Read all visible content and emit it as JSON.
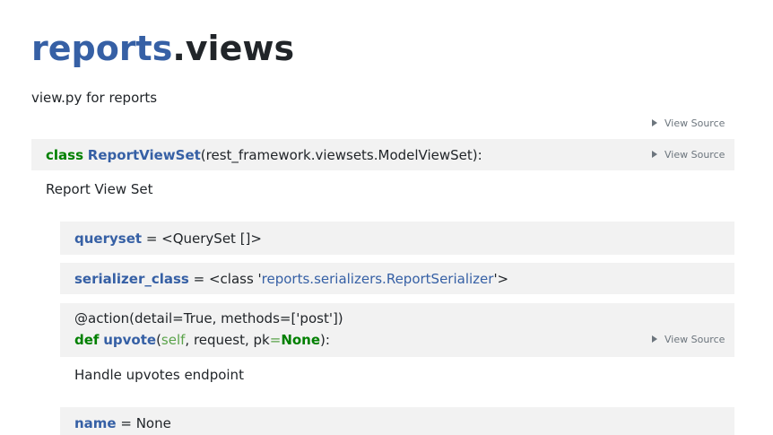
{
  "module": {
    "name": "reports",
    "dot": ".",
    "submodule": "views",
    "docstring": "view.py for reports"
  },
  "view_source_label": "View Source",
  "cls": {
    "keyword": "class",
    "name": "ReportViewSet",
    "base": "(rest_framework.viewsets.ModelViewSet):",
    "doc": "Report View Set"
  },
  "members": {
    "queryset": {
      "name": "queryset",
      "value": " = <QuerySet []>"
    },
    "serializer": {
      "name": "serializer_class",
      "prefix": " = <class '",
      "link": "reports.serializers.ReportSerializer",
      "suffix": "'>"
    },
    "upvote": {
      "decorator": "@action(detail=True, methods=['post'])",
      "keyword": "def",
      "name": "upvote",
      "open": "(",
      "self": "self",
      "mid": ", request, pk",
      "eq": "=",
      "none": "None",
      "close": "):",
      "doc": "Handle upvotes endpoint"
    },
    "name_attr": {
      "name": "name",
      "value": " = None"
    }
  }
}
